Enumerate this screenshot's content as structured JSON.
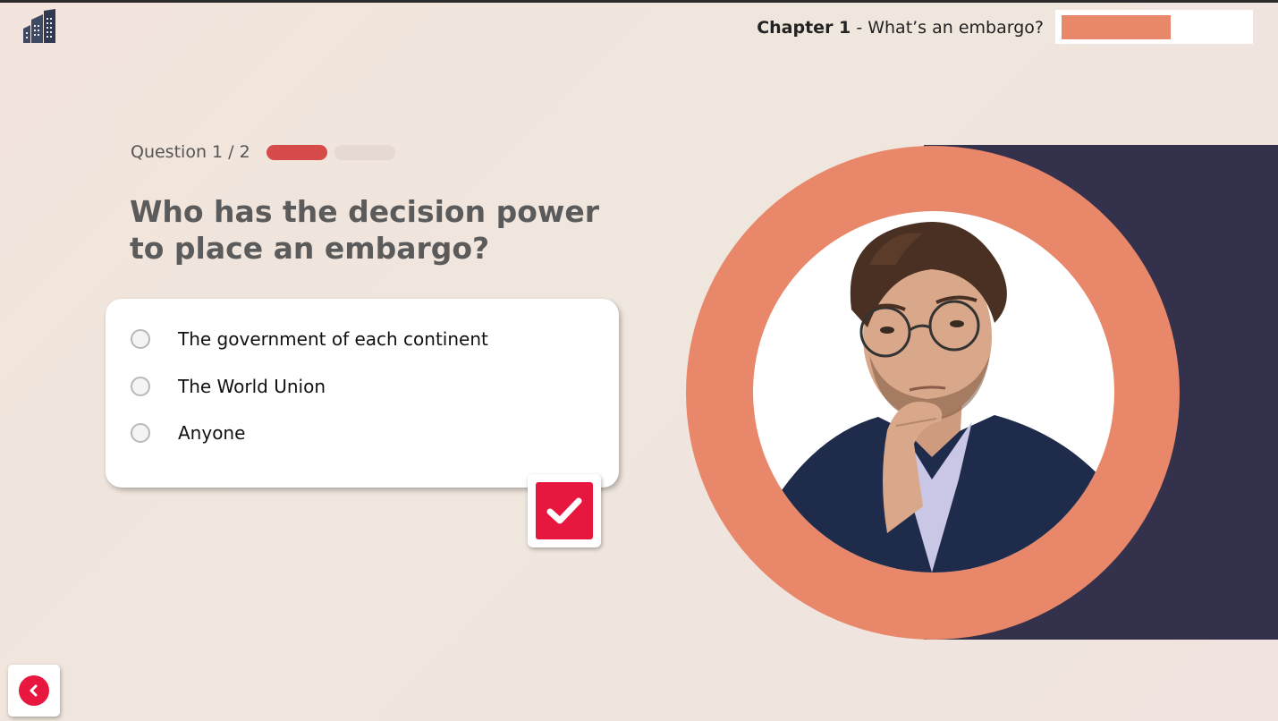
{
  "header": {
    "chapter_label": "Chapter 1",
    "chapter_title": " - What’s an embargo?",
    "progress_fraction": 0.55,
    "progress_color": "#e8876a"
  },
  "quiz": {
    "counter": "Question 1 / 2",
    "progress_pills": [
      {
        "state": "active",
        "color": "#d64a4a"
      },
      {
        "state": "inactive",
        "color": "#e6d9d3"
      }
    ],
    "question": "Who has the decision power to place an embargo?",
    "options": [
      {
        "label": "The government of each continent",
        "selected": false
      },
      {
        "label": "The World Union",
        "selected": false
      },
      {
        "label": "Anyone",
        "selected": false
      }
    ],
    "submit_icon": "checkmark-icon",
    "submit_color": "#e8173f"
  },
  "nav": {
    "back_icon": "chevron-left-icon",
    "logo_icon": "building-logo-icon"
  },
  "illustration": {
    "subject": "man-thinking-photo",
    "ring_color": "#e8876a",
    "panel_color": "#33314b"
  }
}
